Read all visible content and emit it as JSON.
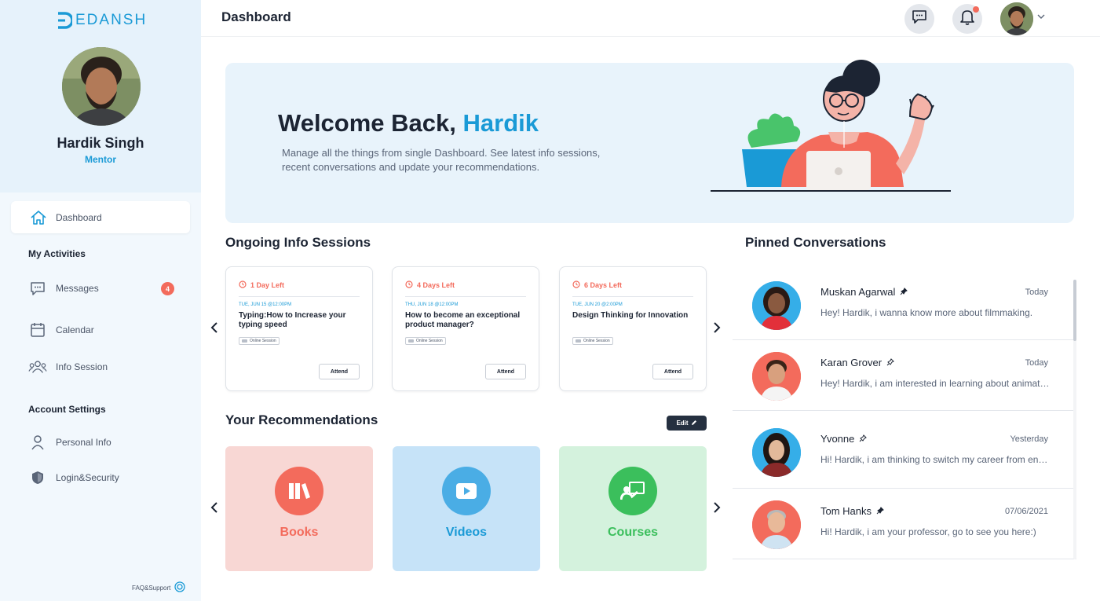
{
  "app": {
    "logo_text": "EDANSH"
  },
  "profile": {
    "name": "Hardik Singh",
    "role": "Mentor"
  },
  "sidebar": {
    "dashboard": "Dashboard",
    "section_activities": "My Activities",
    "messages": "Messages",
    "messages_badge": "4",
    "calendar": "Calendar",
    "info_session": "Info Session",
    "section_account": "Account Settings",
    "personal_info": "Personal Info",
    "login_security": "Login&Security",
    "faq": "FAQ&Support"
  },
  "header": {
    "title": "Dashboard"
  },
  "banner": {
    "welcome_prefix": "Welcome Back,",
    "welcome_name": "Hardik",
    "subtitle": "Manage all the things from single Dashboard. See latest info sessions, recent conversations and update your recommendations."
  },
  "sessions": {
    "title": "Ongoing Info Sessions",
    "items": [
      {
        "days_left": "1 Day Left",
        "date": "TUE, JUN 15 @12:00PM",
        "title": "Typing:How to Increase your typing speed",
        "tag": "Online Session",
        "action": "Attend"
      },
      {
        "days_left": "4 Days Left",
        "date": "THU, JUN 18 @12:00PM",
        "title": "How to become an exceptional product manager?",
        "tag": "Online Session",
        "action": "Attend"
      },
      {
        "days_left": "6 Days Left",
        "date": "TUE, JUN 20 @2:00PM",
        "title": "Design Thinking for Innovation",
        "tag": "Online Session",
        "action": "Attend"
      }
    ]
  },
  "recommendations": {
    "title": "Your Recommendations",
    "edit_label": "Edit",
    "items": [
      {
        "label": "Books",
        "icon": "books-icon",
        "bg": "#f8d7d4",
        "accent": "#f36b5c"
      },
      {
        "label": "Videos",
        "icon": "play-icon",
        "bg": "#c6e3f8",
        "accent": "#1a9ad6"
      },
      {
        "label": "Courses",
        "icon": "presentation-icon",
        "bg": "#d4f2dd",
        "accent": "#3bbf5c"
      }
    ]
  },
  "pinned": {
    "title": "Pinned Conversations",
    "items": [
      {
        "name": "Muskan Agarwal",
        "time": "Today",
        "message": "Hey! Hardik, i wanna know more about filmmaking."
      },
      {
        "name": "Karan Grover",
        "time": "Today",
        "message": "Hey! Hardik, i am interested in learning about animation"
      },
      {
        "name": "Yvonne",
        "time": "Yesterday",
        "message": "Hi! Hardik, i am thinking to switch my career from engineering"
      },
      {
        "name": "Tom Hanks",
        "time": "07/06/2021",
        "message": "Hi! Hardik, i am your professor, go to see you here:)"
      }
    ]
  },
  "colors": {
    "primary": "#1a9ad6",
    "accent": "#f36b5c",
    "dark": "#1c2433"
  }
}
